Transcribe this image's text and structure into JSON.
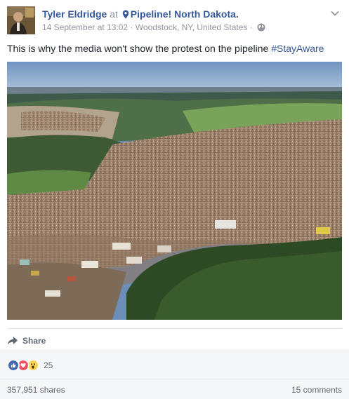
{
  "post": {
    "author": "Tyler Eldridge",
    "at_text": "at",
    "location": "Pipeline! North Dakota.",
    "timestamp": "14 September at 13:02",
    "place": "Woodstock, NY, United States",
    "separator": "·",
    "text": "This is why the media won't show the protest on the pipeline",
    "hashtag": "#StayAware"
  },
  "actions": {
    "share_label": "Share"
  },
  "reactions": {
    "count": "25",
    "types": [
      "like-icon",
      "love-icon",
      "wow-icon"
    ]
  },
  "stats": {
    "shares": "357,951 shares",
    "comments": "15 comments"
  },
  "colors": {
    "link_blue": "#365899",
    "meta_gray": "#90949c",
    "like_blue": "#4267b2",
    "love_red": "#f25268",
    "wow_yellow": "#fcd34d"
  },
  "icons": {
    "avatar": "avatar",
    "location": "map-pin-icon",
    "privacy": "globe-icon",
    "menu": "chevron-down-icon",
    "share": "share-arrow-icon"
  }
}
